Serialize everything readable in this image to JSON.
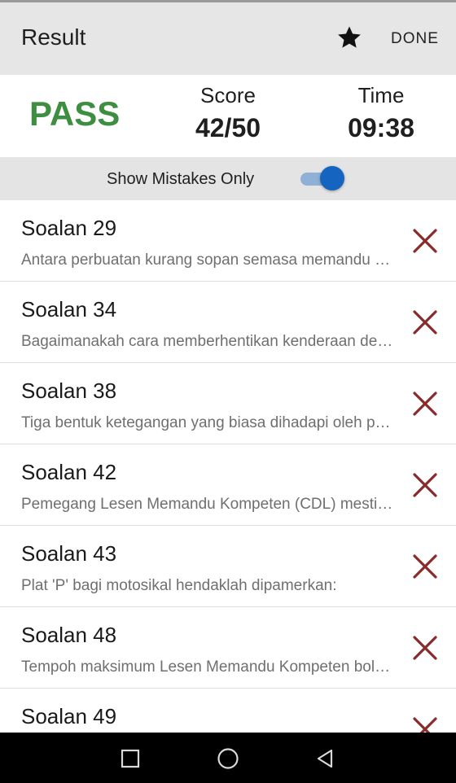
{
  "app_bar": {
    "title": "Result",
    "star_icon": "star-icon",
    "done_label": "DONE"
  },
  "summary": {
    "status": "PASS",
    "status_color": "#3e8e41",
    "score_label": "Score",
    "score_value": "42/50",
    "time_label": "Time",
    "time_value": "09:38"
  },
  "filter": {
    "label": "Show Mistakes Only",
    "enabled": true,
    "accent": "#1565c0"
  },
  "questions": [
    {
      "title": "Soalan 29",
      "text": "Antara perbuatan kurang sopan semasa memandu adalah:",
      "status_icon": "wrong-x-icon"
    },
    {
      "title": "Soalan 34",
      "text": "Bagaimanakah cara memberhentikan kenderaan dengan selamat?",
      "status_icon": "wrong-x-icon"
    },
    {
      "title": "Soalan 38",
      "text": "Tiga bentuk ketegangan yang biasa dihadapi oleh pemandu:",
      "status_icon": "wrong-x-icon"
    },
    {
      "title": "Soalan 42",
      "text": "Pemegang Lesen Memandu Kompeten (CDL) mestilah:",
      "status_icon": "wrong-x-icon"
    },
    {
      "title": "Soalan 43",
      "text": "Plat 'P' bagi motosikal hendaklah dipamerkan:",
      "status_icon": "wrong-x-icon"
    },
    {
      "title": "Soalan 48",
      "text": "Tempoh maksimum Lesen Memandu Kompeten boleh diperbaharui:",
      "status_icon": "wrong-x-icon"
    },
    {
      "title": "Soalan 49",
      "text": "",
      "status_icon": "wrong-x-icon"
    }
  ],
  "wrong_color": "#8b2a2a",
  "nav": {
    "recents_icon": "recents-square-icon",
    "home_icon": "home-circle-icon",
    "back_icon": "back-triangle-icon"
  }
}
